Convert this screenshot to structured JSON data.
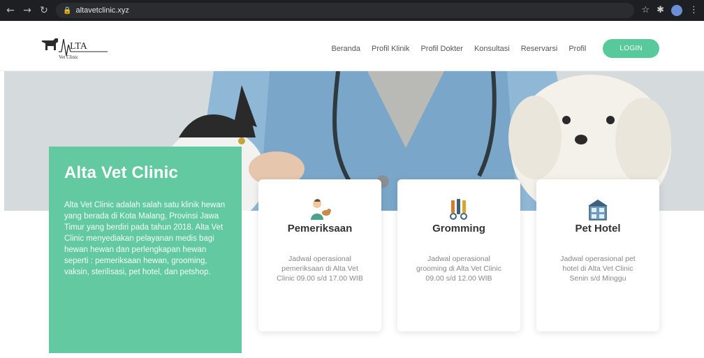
{
  "browser": {
    "url": "altavetclinic.xyz"
  },
  "header": {
    "logo_text": "LTA",
    "logo_sub": "Vet Clinic",
    "nav": [
      "Beranda",
      "Profil Klinik",
      "Profil Dokter",
      "Konsultasi",
      "Reservarsi",
      "Profil"
    ],
    "login_label": "LOGIN"
  },
  "about": {
    "title": "Alta Vet Clinic",
    "description": "Alta Vet Clinic adalah salah satu klinik hewan yang berada di Kota Malang, Provinsi Jawa Timur yang berdiri pada tahun 2018. Alta Vet Clinic menyediakan pelayanan medis bagi hewan hewan dan perlengkapan hewan seperti : pemeriksaan hewan, grooming, vaksin, sterilisasi, pet hotel, dan petshop."
  },
  "services": [
    {
      "title": "Pemeriksaan",
      "icon": "vet-examination-icon",
      "text": "Jadwal operasional pemeriksaan di Alta Vet Clinic 09.00 s/d 17.00 WIB"
    },
    {
      "title": "Gromming",
      "icon": "grooming-tools-icon",
      "text": "Jadwal operasional grooming di Alta Vet Clinic 09.00 s/d 12.00 WIB"
    },
    {
      "title": "Pet Hotel",
      "icon": "pet-hotel-icon",
      "text": "Jadwal operasional pet hotel di Alta Vet Clinic Senin s/d Minggu"
    }
  ],
  "colors": {
    "accent": "#58c99a",
    "card_green": "#63c9a0",
    "scrub_blue": "#8fb8d6"
  }
}
